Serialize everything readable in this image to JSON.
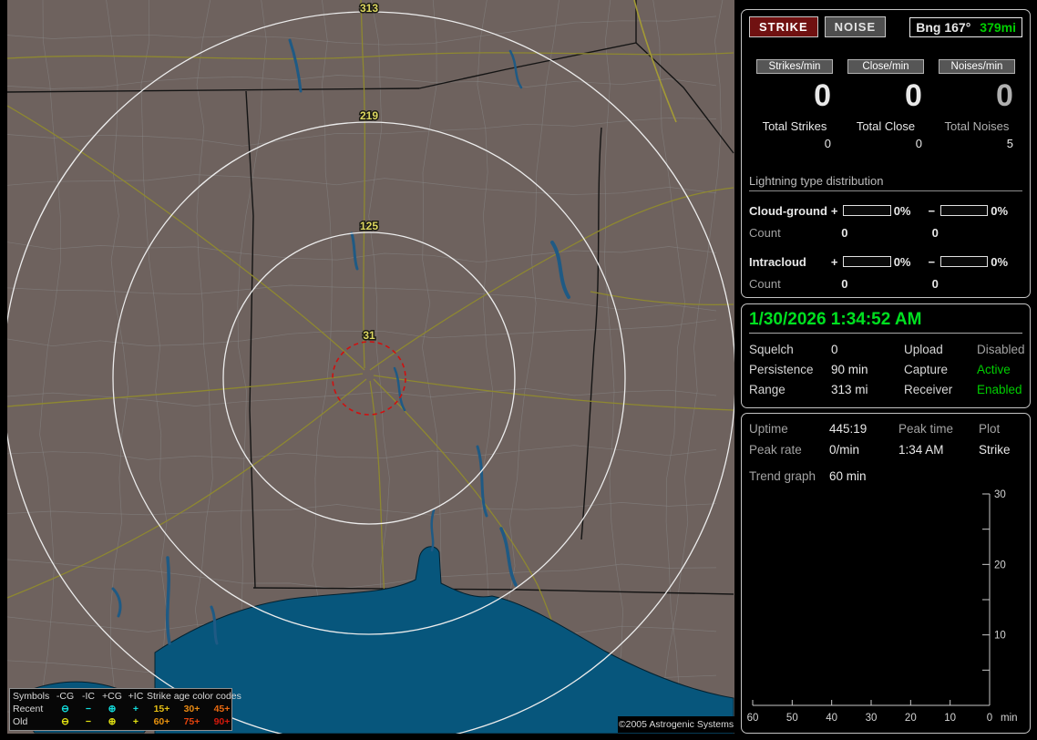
{
  "header": {
    "strike_button": "STRIKE",
    "noise_button": "NOISE",
    "bearing_label": "Bng 167°",
    "bearing_distance": "379mi"
  },
  "counters": {
    "columns": [
      {
        "label": "Strikes/min",
        "value": "0",
        "total_label": "Total Strikes",
        "total_value": "0"
      },
      {
        "label": "Close/min",
        "value": "0",
        "total_label": "Total Close",
        "total_value": "0"
      },
      {
        "label": "Noises/min",
        "value": "0",
        "total_label": "Total Noises",
        "total_value": "5"
      }
    ]
  },
  "distribution": {
    "title": "Lightning type distribution",
    "plus_sign": "+",
    "minus_sign": "−",
    "rows": [
      {
        "name": "Cloud-ground",
        "plus_pct": "0%",
        "minus_pct": "0%",
        "count_label": "Count",
        "plus_count": "0",
        "minus_count": "0"
      },
      {
        "name": "Intracloud",
        "plus_pct": "0%",
        "minus_pct": "0%",
        "count_label": "Count",
        "plus_count": "0",
        "minus_count": "0"
      }
    ]
  },
  "status": {
    "datetime": "1/30/2026 1:34:52 AM",
    "left": [
      {
        "label": "Squelch",
        "value": "0"
      },
      {
        "label": "Persistence",
        "value": "90 min"
      },
      {
        "label": "Range",
        "value": "313 mi"
      }
    ],
    "right": [
      {
        "label": "Upload",
        "value": "Disabled"
      },
      {
        "label": "Capture",
        "value": "Active"
      },
      {
        "label": "Receiver",
        "value": "Enabled"
      }
    ]
  },
  "stats": {
    "uptime_label": "Uptime",
    "uptime_value": "445:19",
    "peak_time_label": "Peak time",
    "peak_time_value": "1:34 AM",
    "plot_label": "Plot",
    "plot_value": "Strike",
    "peak_rate_label": "Peak rate",
    "peak_rate_value": "0/min",
    "trend_label": "Trend graph",
    "trend_value": "60 min"
  },
  "chart_data": {
    "type": "line",
    "title": "Strike rate trend graph (last 60 min)",
    "x_ticks": [
      60,
      50,
      40,
      30,
      20,
      10,
      0
    ],
    "x_unit": "min",
    "y_ticks": [
      30,
      20,
      10
    ],
    "y_minor_ticks": [
      25,
      15,
      5
    ],
    "xlim": [
      60,
      0
    ],
    "ylim": [
      0,
      30
    ],
    "grid": false,
    "legend_position": "none",
    "series": []
  },
  "map": {
    "ring_labels": [
      "313",
      "219",
      "125",
      "31"
    ],
    "copyright": "©2005 Astrogenic Systems"
  },
  "legend": {
    "header": {
      "symbols": "Symbols",
      "cg_neg": "-CG",
      "ic_neg": "-IC",
      "cg_pos": "+CG",
      "ic_pos": "+IC",
      "age_title": "Strike age color codes"
    },
    "rows": [
      {
        "label": "Recent",
        "sym_cg_neg": "⊖",
        "sym_ic_neg": "−",
        "sym_cg_pos": "⊕",
        "sym_ic_pos": "+",
        "ages": [
          {
            "text": "15+",
            "color": "#e6bf13"
          },
          {
            "text": "30+",
            "color": "#e98a12"
          },
          {
            "text": "45+",
            "color": "#ea6a10"
          }
        ]
      },
      {
        "label": "Old",
        "sym_cg_neg": "⊖",
        "sym_ic_neg": "−",
        "sym_cg_pos": "⊕",
        "sym_ic_pos": "+",
        "ages": [
          {
            "text": "60+",
            "color": "#e9920e"
          },
          {
            "text": "75+",
            "color": "#e4430d"
          },
          {
            "text": "90+",
            "color": "#d6190b"
          }
        ]
      }
    ]
  },
  "colors": {
    "accent_green": "#00cf00",
    "status_gray": "#a2a2a2",
    "strike_button_bg": "#701111",
    "ring_label": "#ddd75f",
    "close_ring_red": "#d01010",
    "recent_symbol": "#12dede",
    "old_symbol": "#e3e312",
    "water": "#07567c",
    "land": "#6e625e"
  }
}
